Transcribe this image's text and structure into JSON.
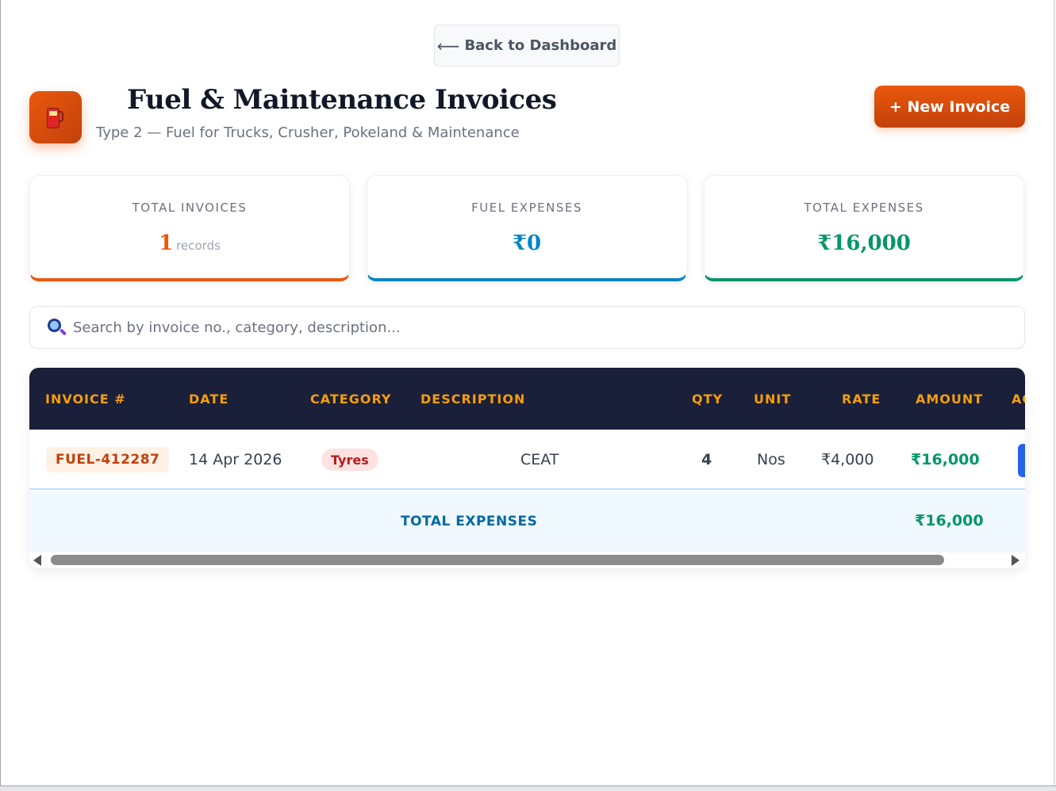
{
  "back_button": {
    "arrow": "⟵",
    "label": "Back to Dashboard"
  },
  "header": {
    "icon": "fuel-pump-icon",
    "title": "Fuel & Maintenance Invoices",
    "subtitle": "Type 2 — Fuel for Trucks, Crusher, Pokeland & Maintenance",
    "new_invoice_label": "+ New Invoice"
  },
  "stats": [
    {
      "label": "TOTAL INVOICES",
      "value": "1",
      "unit": "records",
      "color": "#ea580c"
    },
    {
      "label": "FUEL EXPENSES",
      "value": "₹0",
      "color": "#0284c7"
    },
    {
      "label": "TOTAL EXPENSES",
      "value": "₹16,000",
      "color": "#059669"
    }
  ],
  "search": {
    "icon": "search-icon",
    "placeholder": "Search by invoice no., category, description..."
  },
  "table": {
    "columns": [
      "INVOICE #",
      "DATE",
      "CATEGORY",
      "DESCRIPTION",
      "QTY",
      "UNIT",
      "RATE",
      "AMOUNT",
      "AC"
    ],
    "rows": [
      {
        "invoice_no": "FUEL-412287",
        "date": "14 Apr 2026",
        "category": "Tyres",
        "description": "CEAT",
        "qty": "4",
        "unit": "Nos",
        "rate": "₹4,000",
        "amount": "₹16,000"
      }
    ],
    "footer": {
      "label": "TOTAL EXPENSES",
      "amount": "₹16,000"
    }
  }
}
